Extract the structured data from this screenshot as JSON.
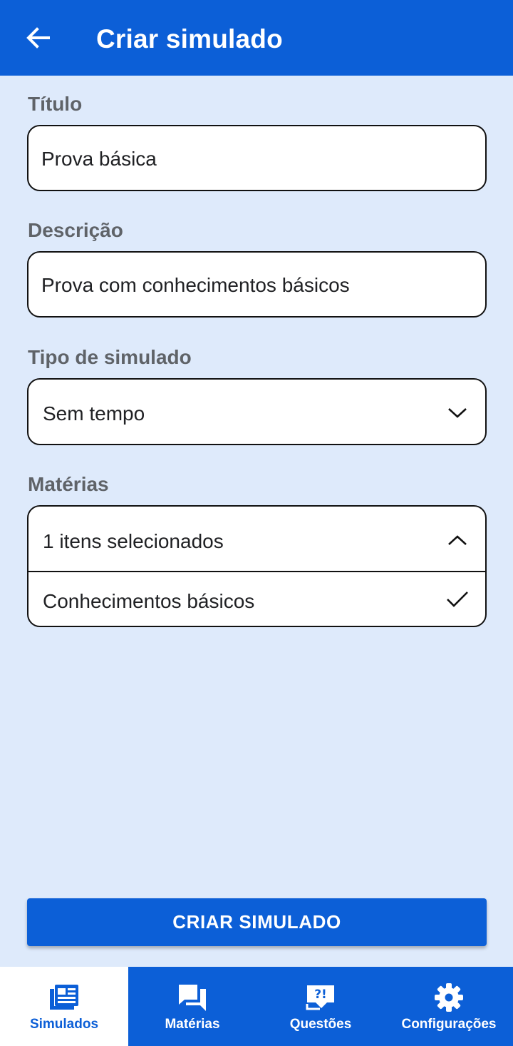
{
  "app": {
    "title": "Criar simulado",
    "accent_color": "#0c5fd7",
    "background_color": "#deeafb"
  },
  "header": {
    "back_icon": "arrow-left-icon",
    "title": "Criar simulado"
  },
  "form": {
    "titulo": {
      "label": "Título",
      "value": "Prova básica"
    },
    "descricao": {
      "label": "Descrição",
      "value": "Prova com conhecimentos básicos"
    },
    "tipo": {
      "label": "Tipo de simulado",
      "selected": "Sem tempo",
      "icon": "chevron-down-icon"
    },
    "materias": {
      "label": "Matérias",
      "summary": "1 itens selecionados",
      "icon": "chevron-up-icon",
      "options": [
        {
          "label": "Conhecimentos básicos",
          "checked": true,
          "icon": "check-icon"
        }
      ]
    }
  },
  "actions": {
    "submit_label": "CRIAR SIMULADO"
  },
  "bottom_nav": {
    "items": [
      {
        "label": "Simulados",
        "icon": "newspaper-icon",
        "active": true
      },
      {
        "label": "Matérias",
        "icon": "forum-icon",
        "active": false
      },
      {
        "label": "Questões",
        "icon": "quiz-icon",
        "active": false
      },
      {
        "label": "Configurações",
        "icon": "gear-icon",
        "active": false
      }
    ]
  }
}
